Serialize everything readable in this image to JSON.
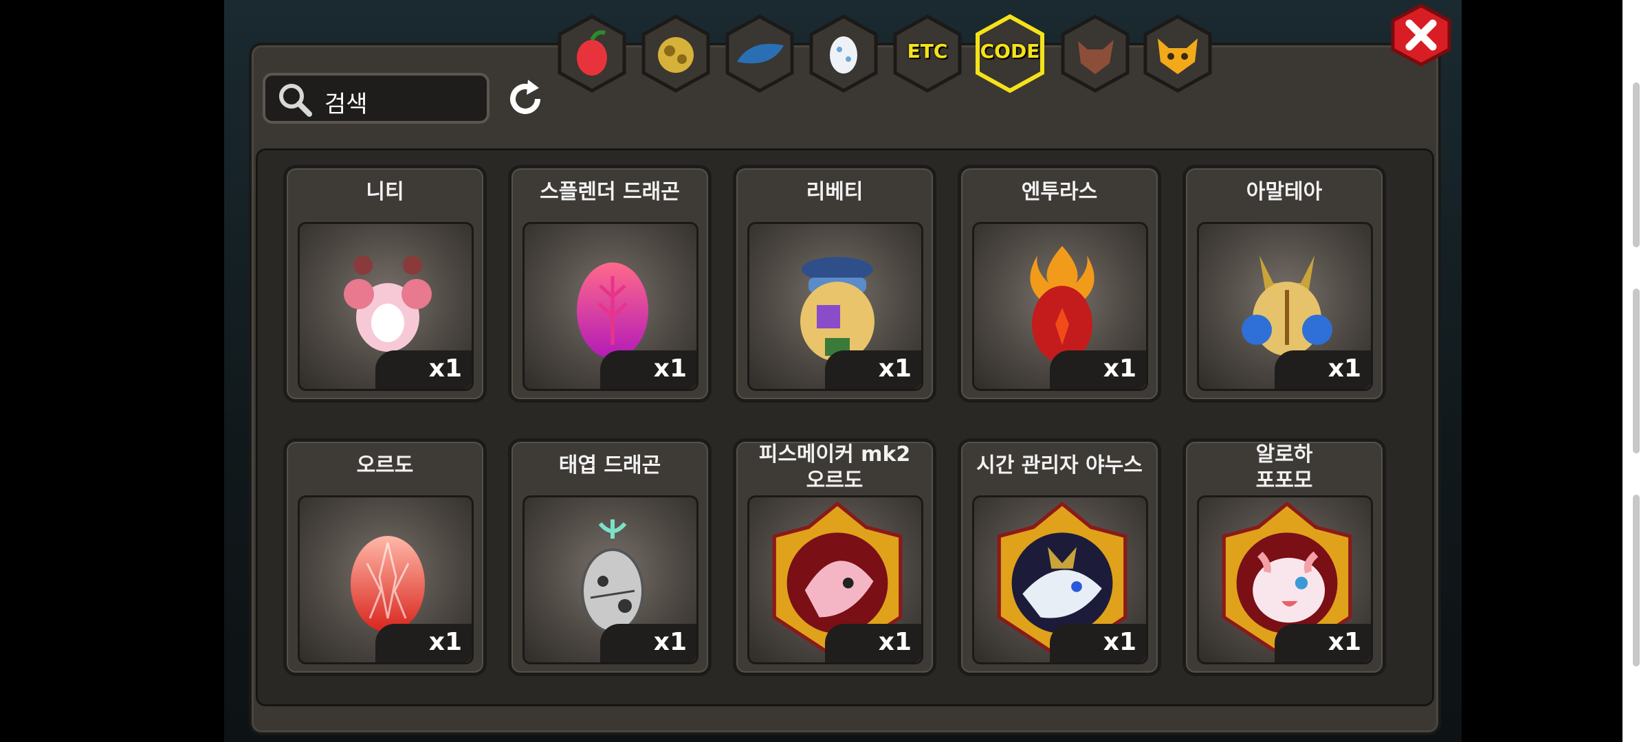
{
  "tabs": [
    {
      "name": "fruit",
      "icon": "fruit-icon"
    },
    {
      "name": "gold",
      "icon": "gold-ore-icon"
    },
    {
      "name": "scale",
      "icon": "dragon-scale-icon"
    },
    {
      "name": "egg",
      "icon": "egg-icon"
    },
    {
      "name": "etc",
      "label": "ETC"
    },
    {
      "name": "code",
      "label": "CODE",
      "active": true
    },
    {
      "name": "beast",
      "icon": "wolf-head-icon"
    },
    {
      "name": "mask",
      "icon": "demon-mask-icon"
    }
  ],
  "search": {
    "label": "검색"
  },
  "items": [
    {
      "title": "니티",
      "qty": "x1",
      "art": "pink-dragon"
    },
    {
      "title": "스플렌더 드래곤",
      "qty": "x1",
      "art": "pink-egg"
    },
    {
      "title": "리베티",
      "qty": "x1",
      "art": "pilot-creature"
    },
    {
      "title": "엔투라스",
      "qty": "x1",
      "art": "flame-egg"
    },
    {
      "title": "아말테아",
      "qty": "x1",
      "art": "blue-gold-creature"
    },
    {
      "title": "오르도",
      "qty": "x1",
      "art": "crystal-egg"
    },
    {
      "title": "태엽 드래곤",
      "qty": "x1",
      "art": "clockwork-egg"
    },
    {
      "title_line1": "피스메이커 mk2",
      "title_line2": "오르도",
      "qty": "x1",
      "art": "pink-dragon-portrait"
    },
    {
      "title": "시간 관리자 야누스",
      "qty": "x1",
      "art": "white-dragon-portrait"
    },
    {
      "title_line1": "알로하",
      "title_line2": "포포모",
      "qty": "x1",
      "art": "cute-dragon-portrait"
    }
  ],
  "colors": {
    "accent_yellow": "#f5e21a",
    "close_red": "#d81e24",
    "panel": "#3b3833"
  }
}
